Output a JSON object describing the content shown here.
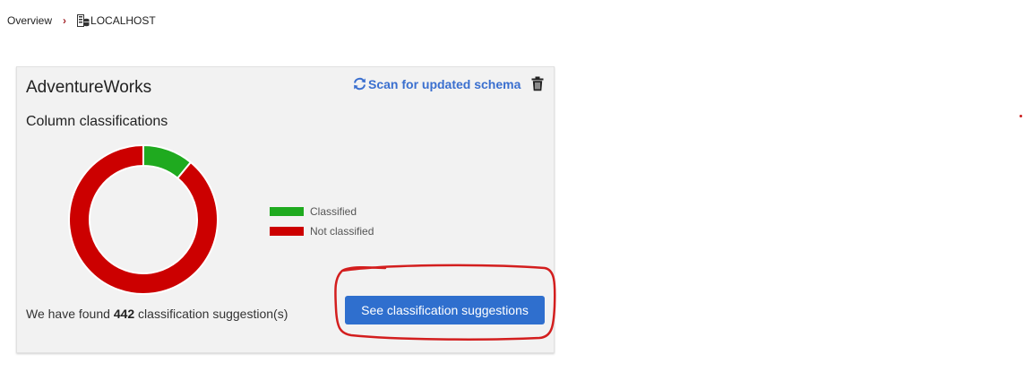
{
  "breadcrumb": {
    "overview": "Overview",
    "separator": "›",
    "server_icon": "server-icon",
    "server": "LOCALHOST"
  },
  "card": {
    "database_title": "AdventureWorks",
    "scan_label": "Scan for updated schema",
    "scan_icon": "refresh-icon",
    "delete_icon": "trash-icon",
    "section_title": "Column classifications",
    "found_prefix": "We have found ",
    "found_count": "442",
    "found_suffix": " classification suggestion(s)",
    "suggest_button": "See classification suggestions"
  },
  "colors": {
    "classified": "#1faa1f",
    "not_classified": "#cc0000",
    "accent_blue": "#2f6fce",
    "link_blue": "#3a6fcf",
    "annotation_red": "#d31e1e"
  },
  "chart_data": {
    "type": "pie",
    "donut": true,
    "categories": [
      "Classified",
      "Not classified"
    ],
    "values": [
      11,
      89
    ],
    "colors": [
      "#1faa1f",
      "#cc0000"
    ],
    "legend": "right"
  }
}
